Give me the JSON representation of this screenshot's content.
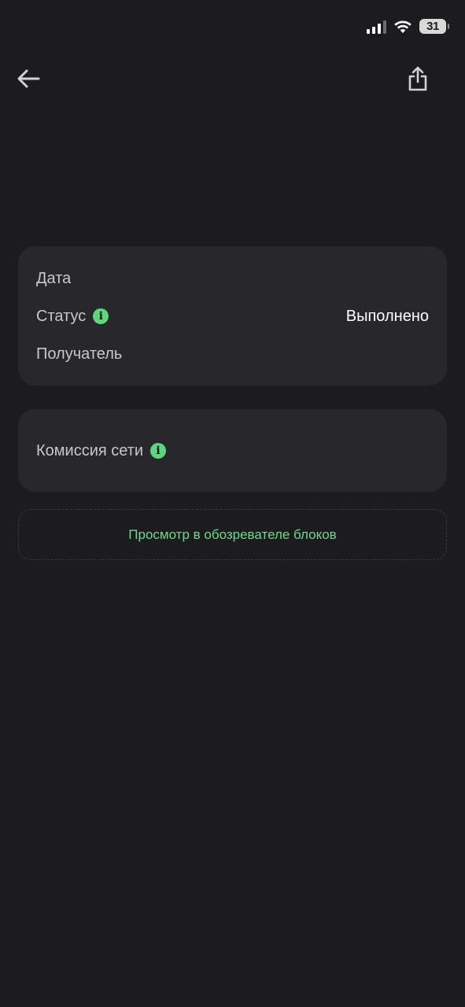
{
  "status_bar": {
    "battery_level": "31",
    "icons": [
      "cellular-signal-icon",
      "wifi-icon",
      "battery-icon"
    ]
  },
  "nav": {
    "back_icon": "arrow-left-icon",
    "share_icon": "share-icon"
  },
  "details_card": {
    "rows": [
      {
        "label": "Дата",
        "value": ""
      },
      {
        "label": "Статус",
        "value": "Выполнено",
        "info_icon": "info-icon"
      },
      {
        "label": "Получатель",
        "value": ""
      }
    ]
  },
  "fee_card": {
    "label": "Комиссия сети",
    "value": "",
    "info_icon": "info-icon"
  },
  "explorer_link": {
    "label": "Просмотр в обозревателе блоков"
  },
  "colors": {
    "background": "#1c1c1e",
    "card": "#28282b",
    "accent_green": "#5ed57e",
    "link_green": "#6fd88e",
    "text_primary": "#ffffff",
    "text_secondary": "#c7c7cc"
  }
}
